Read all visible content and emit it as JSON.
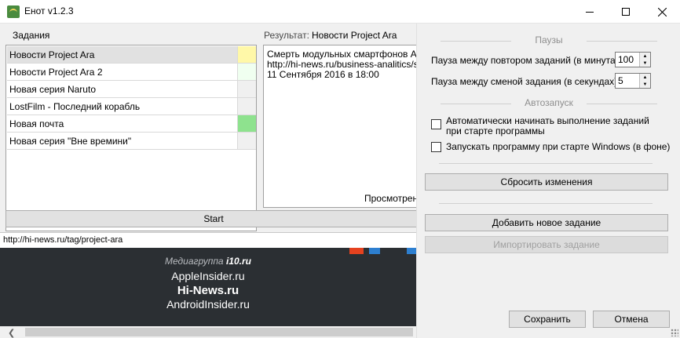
{
  "window": {
    "title": "Енот v1.2.3",
    "icon": "raccoon-icon"
  },
  "tasks": {
    "label": "Задания",
    "items": [
      {
        "label": "Новости Project Ara",
        "status_color": "#fff8a8",
        "selected": true
      },
      {
        "label": "Новости Project Ara 2",
        "status_color": "#f0fff0",
        "selected": false
      },
      {
        "label": "Новая серия Naruto",
        "status_color": "#f0f0f0",
        "selected": false
      },
      {
        "label": "LostFilm - Последний корабль",
        "status_color": "#f0f0f0",
        "selected": false
      },
      {
        "label": "Новая почта",
        "status_color": "#8ee28e",
        "selected": false
      },
      {
        "label": "Новая серия \"Вне времини\"",
        "status_color": "#f0f0f0",
        "selected": false
      }
    ]
  },
  "result": {
    "caption": "Результат:",
    "title": "Новости Project Ara",
    "lines": [
      "Смерть модульных смартфонов Ara –",
      "http://hi-news.ru/business-analitics/sme",
      "11 Сентября 2016 в 18:00"
    ],
    "viewed_label": "Просмотрен"
  },
  "start_button": "Start",
  "browser": {
    "url": "http://hi-news.ru/tag/project-ara",
    "media_prefix": "Медиагруппа",
    "media_brand": "i10.ru",
    "lines": [
      "AppleInsider.ru",
      "Hi-News.ru",
      "AndroidInsider.ru"
    ]
  },
  "settings": {
    "pauses_title": "Паузы",
    "repeat_label": "Пауза между повтором заданий (в минутах):",
    "repeat_value": "100",
    "switch_label": "Пауза между сменой задания (в секундах):",
    "switch_value": "5",
    "autostart_title": "Автозапуск",
    "auto_run_line1": "Автоматически начинать выполнение заданий",
    "auto_run_line2": "при старте программы",
    "auto_run_checked": false,
    "win_start_label": "Запускать программу при старте Windows (в фоне)",
    "win_start_checked": false,
    "reset_button": "Сбросить изменения",
    "add_button": "Добавить новое задание",
    "import_button": "Импортировать задание",
    "save_button": "Сохранить",
    "cancel_button": "Отмена"
  }
}
